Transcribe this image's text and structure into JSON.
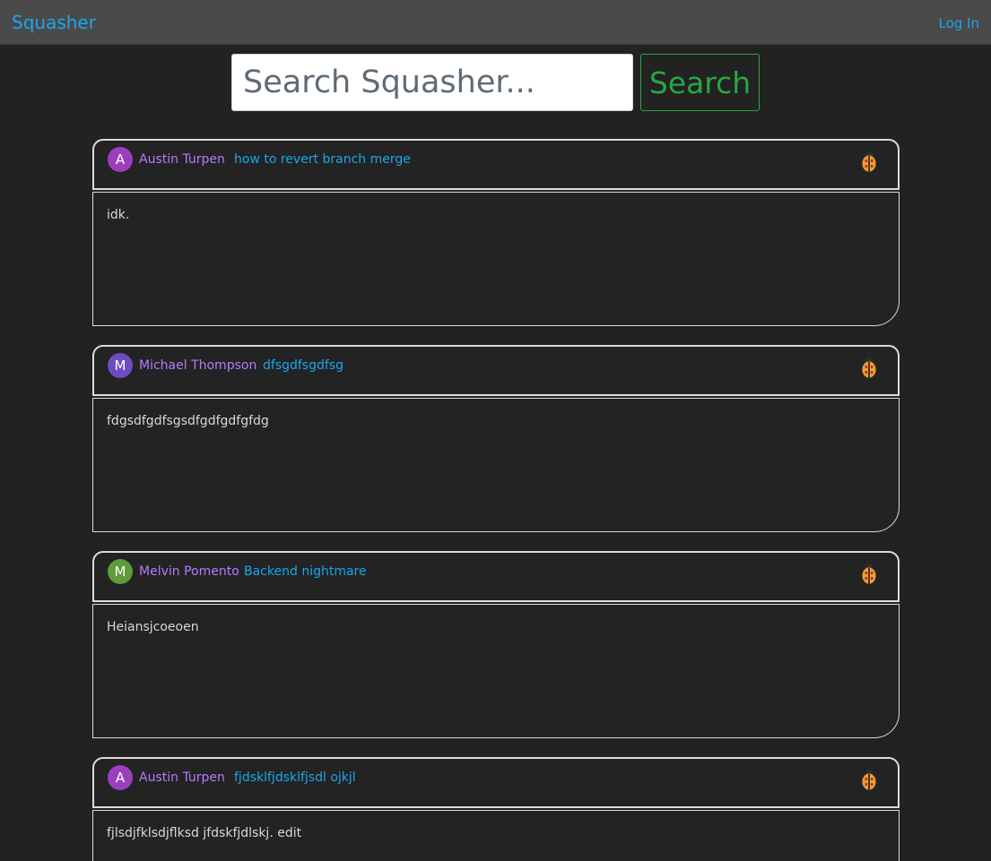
{
  "app": {
    "brand": "Squasher",
    "login_label": "Log In"
  },
  "search": {
    "placeholder": "Search Squasher...",
    "value": "",
    "button_label": "Search"
  },
  "colors": {
    "brand": "#1aa7ec",
    "author": "#b57bff",
    "search_button": "#28a745",
    "bug": "#f0a030"
  },
  "posts": [
    {
      "avatar_letter": "A",
      "avatar_color": "#9b3fbf",
      "author": "Austin Turpen",
      "title": "how to revert branch merge",
      "body": "idk.",
      "icon": "bug-icon"
    },
    {
      "avatar_letter": "M",
      "avatar_color": "#6f4bc2",
      "author": "Michael Thompson",
      "title": "dfsgdfsgdfsg",
      "body": "fdgsdfgdfsgsdfgdfgdfgfdg",
      "icon": "bug-icon"
    },
    {
      "avatar_letter": "M",
      "avatar_color": "#5f9a3b",
      "author": "Melvin Pomento",
      "title": "Backend nightmare",
      "body": "Heiansjcoeoen",
      "icon": "bug-icon"
    },
    {
      "avatar_letter": "A",
      "avatar_color": "#9b3fbf",
      "author": "Austin Turpen",
      "title": "fjdsklfjdsklfjsdl ojkjl",
      "body": "fjlsdjfklsdjflksd jfdskfjdlskj. edit",
      "icon": "bug-icon"
    }
  ]
}
